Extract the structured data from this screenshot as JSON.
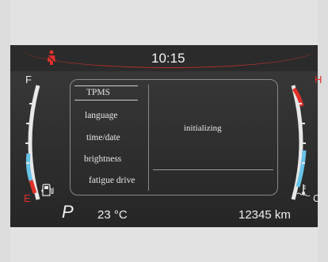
{
  "clock": {
    "time": "10:15"
  },
  "fuel_gauge": {
    "full_label": "F",
    "empty_label": "E"
  },
  "temp_gauge": {
    "hot_label": "H",
    "cold_label": "C"
  },
  "menu": {
    "items": [
      {
        "label": "TPMS",
        "selected": true
      },
      {
        "label": "language"
      },
      {
        "label": "time/date"
      },
      {
        "label": "brightness"
      },
      {
        "label": "fatigue drive"
      }
    ],
    "status": "initializing"
  },
  "bottom": {
    "gear": "P",
    "outside_temp": "23 °C",
    "odometer": "12345 km"
  },
  "colors": {
    "warning_red": "#e0302a",
    "gauge_blue": "#69c3e8"
  },
  "icons": {
    "seatbelt": "seatbelt-warning-icon",
    "fuel": "fuel-pump-icon",
    "coolant": "coolant-temp-icon"
  }
}
